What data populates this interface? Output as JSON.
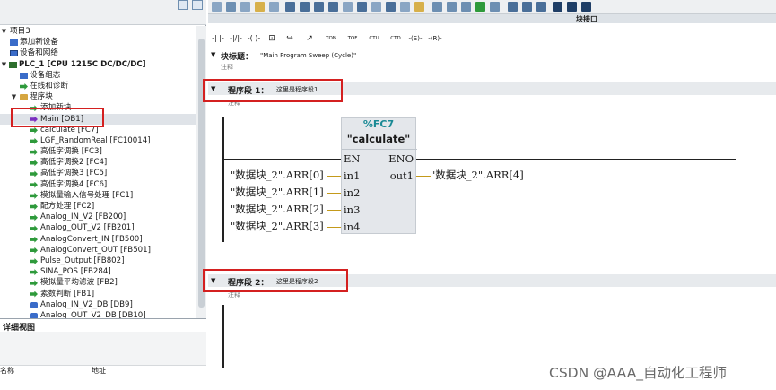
{
  "tree": {
    "items": [
      {
        "label": "项目3",
        "icon": "project-icon"
      },
      {
        "label": "添加新设备",
        "icon": "add-device-icon"
      },
      {
        "label": "设备和网络",
        "icon": "network-icon"
      },
      {
        "label": "PLC_1 [CPU 1215C DC/DC/DC]",
        "icon": "cpu-icon"
      },
      {
        "label": "设备组态",
        "icon": "device-config-icon"
      },
      {
        "label": "在线和诊断",
        "icon": "online-diagnostics-icon"
      },
      {
        "label": "程序块",
        "icon": "folder-icon"
      },
      {
        "label": "添加新块",
        "icon": "add-block-icon"
      },
      {
        "label": "Main [OB1]",
        "icon": "ob-block-icon"
      },
      {
        "label": "calculate [FC7]",
        "icon": "fc-block-icon"
      },
      {
        "label": "LGF_RandomReal [FC10014]",
        "icon": "fc-block-icon"
      },
      {
        "label": "高低字调换 [FC3]",
        "icon": "fc-block-icon"
      },
      {
        "label": "高低字调换2 [FC4]",
        "icon": "fc-block-icon"
      },
      {
        "label": "高低字调换3 [FC5]",
        "icon": "fc-block-icon"
      },
      {
        "label": "高低字调换4 [FC6]",
        "icon": "fc-block-icon"
      },
      {
        "label": "模拟量输入信号处理 [FC1]",
        "icon": "fc-block-icon"
      },
      {
        "label": "配方处理 [FC2]",
        "icon": "fc-block-icon"
      },
      {
        "label": "Analog_IN_V2 [FB200]",
        "icon": "fb-block-icon"
      },
      {
        "label": "Analog_OUT_V2 [FB201]",
        "icon": "fb-block-icon"
      },
      {
        "label": "AnalogConvert_IN [FB500]",
        "icon": "fb-block-icon"
      },
      {
        "label": "AnalogConvert_OUT [FB501]",
        "icon": "fb-block-icon"
      },
      {
        "label": "Pulse_Output [FB802]",
        "icon": "fb-block-icon"
      },
      {
        "label": "SINA_POS [FB284]",
        "icon": "fb-block-icon"
      },
      {
        "label": "模拟量平均滤波 [FB2]",
        "icon": "fb-block-icon"
      },
      {
        "label": "素数判断 [FB1]",
        "icon": "fb-block-icon"
      },
      {
        "label": "Analog_IN_V2_DB [DB9]",
        "icon": "db-block-icon"
      },
      {
        "label": "Analog_OUT_V2_DB [DB10]",
        "icon": "db-block-icon"
      }
    ]
  },
  "detail": {
    "title": "详细视图",
    "col_name": "名称",
    "col_address": "地址"
  },
  "block_interface": {
    "label": "块接口"
  },
  "lad_toolbar": {
    "items": [
      "TON",
      "TOF",
      "CTU",
      "CTD"
    ]
  },
  "block_title": {
    "label": "块标题：",
    "value": "\"Main Program Sweep (Cycle)\"",
    "comment": "注释"
  },
  "networks": [
    {
      "label": "程序段 1：",
      "title": "这里是程序段1",
      "comment": "注释"
    },
    {
      "label": "程序段 2：",
      "title": "这里是程序段2",
      "comment": "注释"
    }
  ],
  "fc_box": {
    "number": "%FC7",
    "name": "\"calculate\"",
    "en": "EN",
    "eno": "ENO",
    "inputs": [
      "in1",
      "in2",
      "in3",
      "in4"
    ],
    "output": "out1",
    "input_operands": [
      "\"数据块_2\".ARR[0]",
      "\"数据块_2\".ARR[1]",
      "\"数据块_2\".ARR[2]",
      "\"数据块_2\".ARR[3]"
    ],
    "output_operand": "\"数据块_2\".ARR[4]"
  },
  "watermark": "CSDN @AAA_自动化工程师",
  "colors": {
    "highlight": "#d42020",
    "fc_number": "#1a8a95",
    "wire": "#c49a1a"
  }
}
